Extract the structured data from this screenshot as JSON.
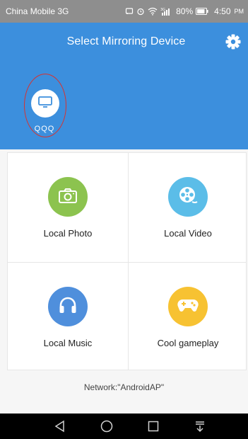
{
  "status_bar": {
    "carrier": "China Mobile 3G",
    "network_type": "3G",
    "battery": "80%",
    "time": "4:50",
    "ampm": "PM"
  },
  "header": {
    "title": "Select Mirroring Device"
  },
  "devices": [
    {
      "name": "QQQ",
      "icon": "tv-icon",
      "selected": true
    }
  ],
  "features": [
    {
      "label": "Local Photo",
      "icon": "camera-icon",
      "color": "#8cc34f"
    },
    {
      "label": "Local Video",
      "icon": "film-reel-icon",
      "color": "#5bbde8"
    },
    {
      "label": "Local Music",
      "icon": "headphones-icon",
      "color": "#4f8fdc"
    },
    {
      "label": "Cool gameplay",
      "icon": "gamepad-icon",
      "color": "#f7c232"
    }
  ],
  "footer": {
    "network": "Network:\"AndroidAP\""
  },
  "colors": {
    "accent": "#3c8fdd",
    "selection_ring": "#d8322f"
  }
}
